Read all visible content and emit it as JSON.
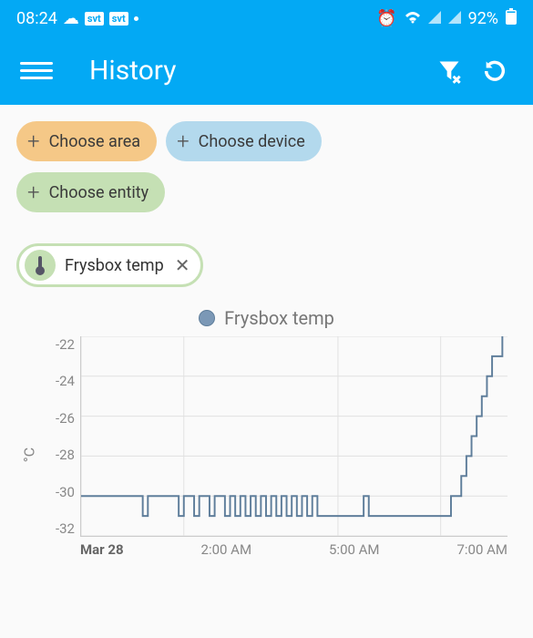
{
  "status": {
    "time": "08:24",
    "badge1": "svt",
    "badge2": "svt",
    "battery": "92%"
  },
  "appbar": {
    "title": "History"
  },
  "chips": {
    "area": "Choose area",
    "device": "Choose device",
    "entity": "Choose entity",
    "selected": "Frysbox temp"
  },
  "legend": {
    "series": "Frysbox temp"
  },
  "chart_data": {
    "type": "line",
    "title": "",
    "xlabel": "",
    "ylabel": "°C",
    "ylim": [
      -32,
      -22
    ],
    "y_ticks": [
      "-22",
      "-24",
      "-26",
      "-28",
      "-30",
      "-32"
    ],
    "x_ticks": [
      "Mar 28",
      "2:00 AM",
      "5:00 AM",
      "7:00 AM"
    ],
    "x_time_start_h": 0,
    "x_time_end_h": 8.3,
    "series": [
      {
        "name": "Frysbox temp",
        "color": "#5f7e9b",
        "data": [
          {
            "t": 0.0,
            "v": -30.0
          },
          {
            "t": 1.0,
            "v": -30.0
          },
          {
            "t": 1.2,
            "v": -31.0
          },
          {
            "t": 1.3,
            "v": -30.0
          },
          {
            "t": 1.8,
            "v": -30.0
          },
          {
            "t": 1.9,
            "v": -31.0
          },
          {
            "t": 2.0,
            "v": -30.0
          },
          {
            "t": 2.2,
            "v": -31.0
          },
          {
            "t": 2.3,
            "v": -30.0
          },
          {
            "t": 2.5,
            "v": -31.0
          },
          {
            "t": 2.6,
            "v": -30.0
          },
          {
            "t": 2.8,
            "v": -31.0
          },
          {
            "t": 2.9,
            "v": -30.0
          },
          {
            "t": 3.0,
            "v": -31.0
          },
          {
            "t": 3.1,
            "v": -30.0
          },
          {
            "t": 3.2,
            "v": -31.0
          },
          {
            "t": 3.3,
            "v": -30.0
          },
          {
            "t": 3.4,
            "v": -31.0
          },
          {
            "t": 3.5,
            "v": -30.0
          },
          {
            "t": 3.6,
            "v": -31.0
          },
          {
            "t": 3.7,
            "v": -30.0
          },
          {
            "t": 3.8,
            "v": -31.0
          },
          {
            "t": 3.9,
            "v": -30.0
          },
          {
            "t": 4.0,
            "v": -31.0
          },
          {
            "t": 4.1,
            "v": -30.0
          },
          {
            "t": 4.2,
            "v": -31.0
          },
          {
            "t": 4.3,
            "v": -30.0
          },
          {
            "t": 4.4,
            "v": -31.0
          },
          {
            "t": 4.5,
            "v": -30.0
          },
          {
            "t": 4.6,
            "v": -31.0
          },
          {
            "t": 4.8,
            "v": -31.0
          },
          {
            "t": 5.0,
            "v": -31.0
          },
          {
            "t": 5.4,
            "v": -31.0
          },
          {
            "t": 5.5,
            "v": -30.0
          },
          {
            "t": 5.6,
            "v": -31.0
          },
          {
            "t": 5.7,
            "v": -31.0
          },
          {
            "t": 6.0,
            "v": -31.0
          },
          {
            "t": 6.5,
            "v": -31.0
          },
          {
            "t": 7.0,
            "v": -31.0
          },
          {
            "t": 7.2,
            "v": -30.0
          },
          {
            "t": 7.4,
            "v": -29.0
          },
          {
            "t": 7.5,
            "v": -28.0
          },
          {
            "t": 7.6,
            "v": -27.0
          },
          {
            "t": 7.7,
            "v": -26.0
          },
          {
            "t": 7.8,
            "v": -25.0
          },
          {
            "t": 7.9,
            "v": -24.0
          },
          {
            "t": 8.0,
            "v": -23.0
          },
          {
            "t": 8.2,
            "v": -22.0
          }
        ]
      }
    ]
  }
}
